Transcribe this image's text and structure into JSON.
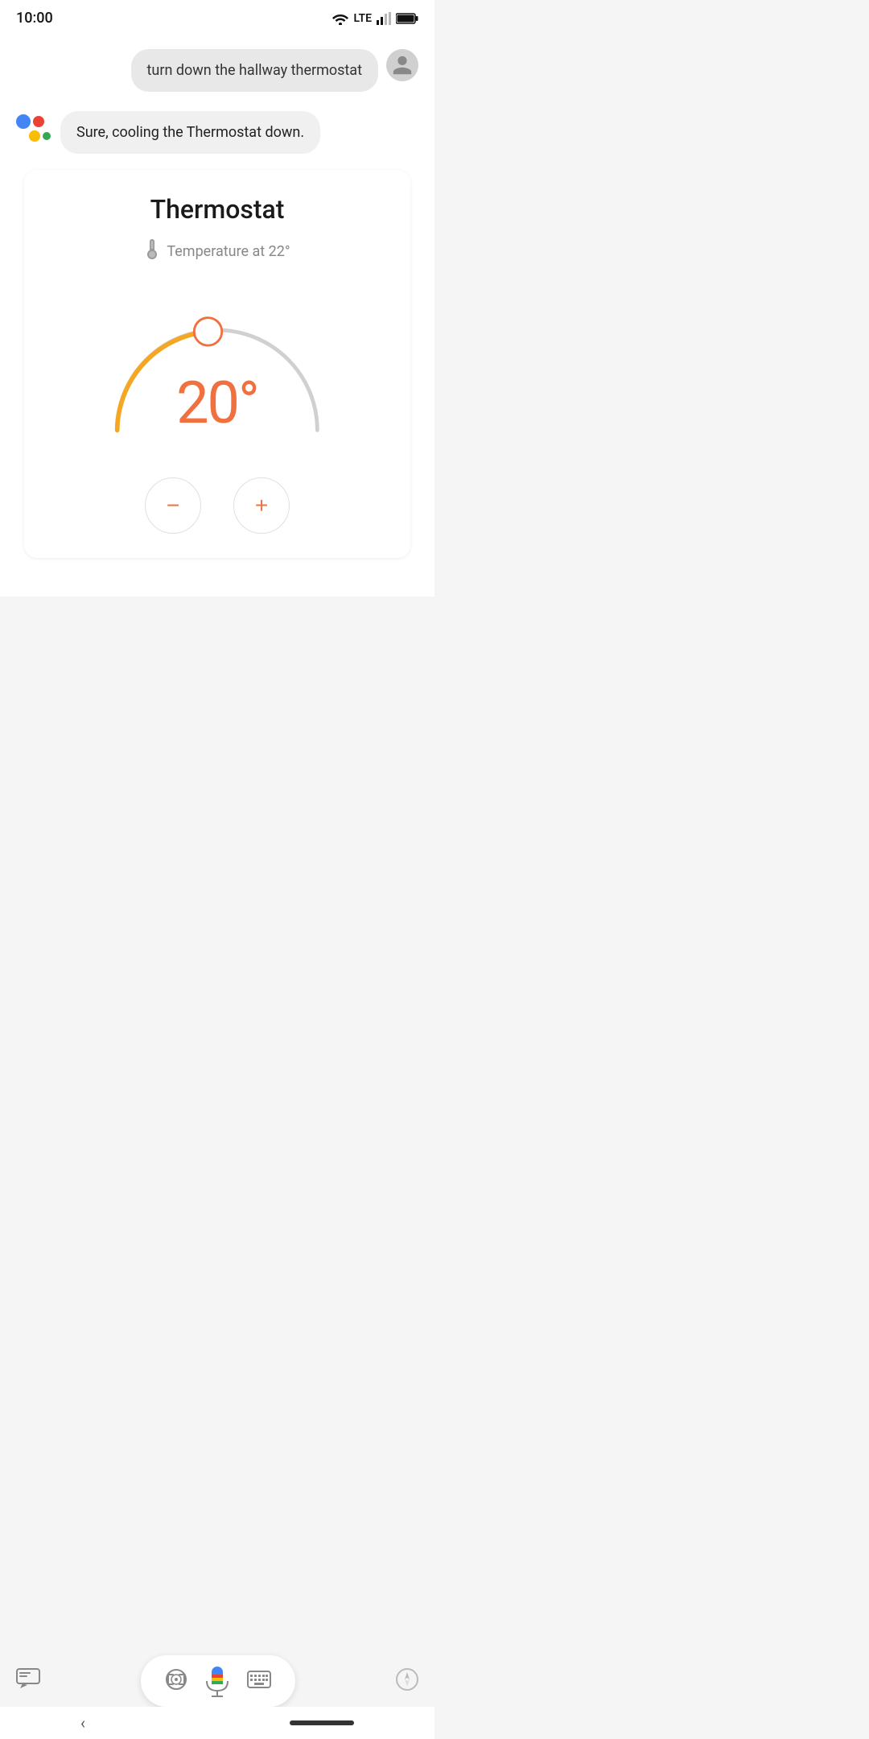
{
  "statusBar": {
    "time": "10:00",
    "lte": "LTE"
  },
  "userMessage": {
    "text": "turn down the hallway thermostat"
  },
  "assistantResponse": {
    "text": "Sure, cooling the Thermostat down."
  },
  "thermostat": {
    "title": "Thermostat",
    "temperatureLabel": "Temperature at 22°",
    "currentTemp": "20°",
    "minusLabel": "−",
    "plusLabel": "+"
  },
  "bottomBar": {
    "cameraIconLabel": "camera-icon",
    "micIconLabel": "mic-icon",
    "keyboardIconLabel": "keyboard-icon",
    "compassIconLabel": "compass-icon",
    "messagesIconLabel": "messages-icon"
  }
}
